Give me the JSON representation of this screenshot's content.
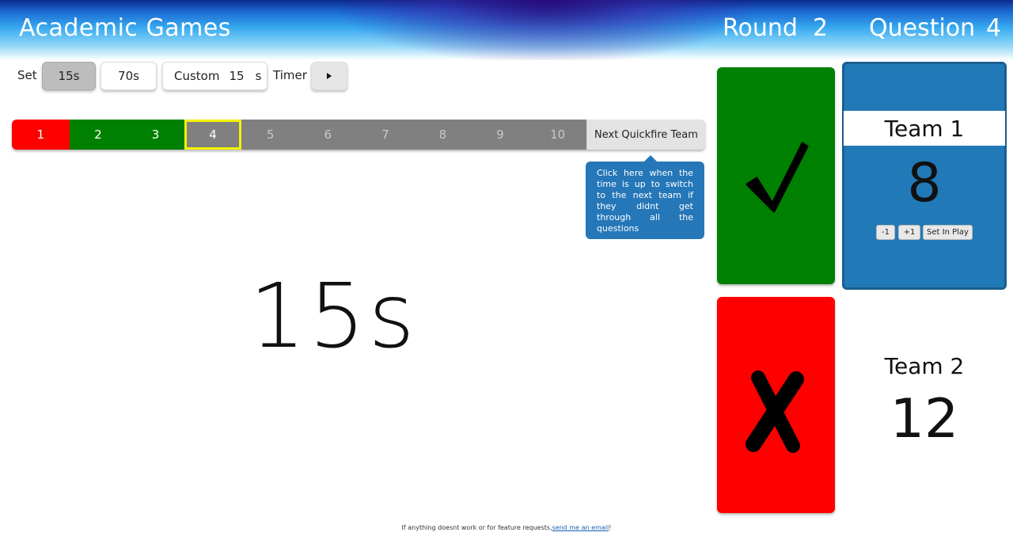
{
  "header": {
    "title": "Academic Games",
    "round_label": "Round",
    "round_value": "2",
    "question_label": "Question",
    "question_value": "4"
  },
  "timer_controls": {
    "set_label": "Set",
    "preset_15": "15s",
    "preset_70": "70s",
    "custom_label": "Custom",
    "custom_value": "15",
    "custom_unit": "s",
    "timer_label": "Timer",
    "play_icon": "play-icon"
  },
  "question_bar": {
    "cells": [
      {
        "label": "1",
        "state": "wrong"
      },
      {
        "label": "2",
        "state": "correct"
      },
      {
        "label": "3",
        "state": "correct"
      },
      {
        "label": "4",
        "state": "current"
      },
      {
        "label": "5",
        "state": "pending"
      },
      {
        "label": "6",
        "state": "pending"
      },
      {
        "label": "7",
        "state": "pending"
      },
      {
        "label": "8",
        "state": "pending"
      },
      {
        "label": "9",
        "state": "pending"
      },
      {
        "label": "10",
        "state": "pending"
      }
    ],
    "next_team_label": "Next Quickfire Team",
    "tooltip": "Click here when the time is up to switch to the next team if they didnt get through all the questions"
  },
  "timer_display": "15s",
  "answer_buttons": {
    "correct_icon": "checkmark-icon",
    "wrong_icon": "x-mark-icon",
    "correct_color": "#008000",
    "wrong_color": "#ff0000"
  },
  "teams": [
    {
      "name": "Team 1",
      "score": "8",
      "active": true,
      "minus_label": "-1",
      "plus_label": "+1",
      "set_in_play_label": "Set In Play"
    },
    {
      "name": "Team 2",
      "score": "12",
      "active": false
    }
  ],
  "colors": {
    "active_team": "#2279b7",
    "current_question_outline": "#f2f200"
  },
  "footer": {
    "text": "If anything doesnt work or for feature requests,",
    "link_text": "send me an email",
    "suffix": "!"
  }
}
